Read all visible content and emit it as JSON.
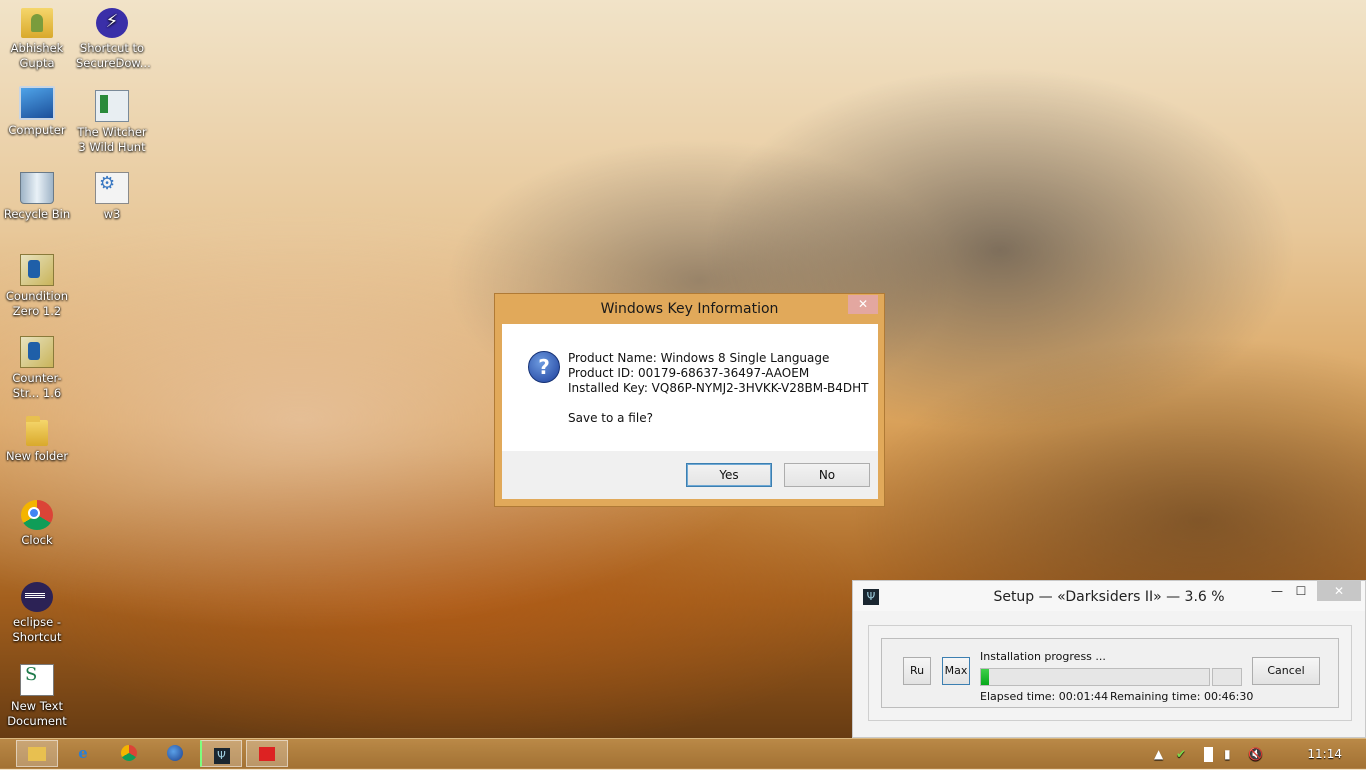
{
  "desktop": {
    "icons": [
      {
        "label": "Abhishek Gupta",
        "icon": "user-folder-icon"
      },
      {
        "label": "Shortcut to SecureDow...",
        "icon": "bolt-icon"
      },
      {
        "label": "Computer",
        "icon": "computer-icon"
      },
      {
        "label": "The Witcher 3 Wild Hunt",
        "icon": "witcher-icon"
      },
      {
        "label": "Recycle Bin",
        "icon": "recycle-bin-icon"
      },
      {
        "label": "w3",
        "icon": "settings-file-icon"
      },
      {
        "label": "Coundition Zero 1.2",
        "icon": "cs-icon"
      },
      {
        "label": "Counter-Str... 1.6",
        "icon": "cs-icon"
      },
      {
        "label": "New folder",
        "icon": "folder-icon"
      },
      {
        "label": "Clock",
        "icon": "chrome-icon"
      },
      {
        "label": "eclipse - Shortcut",
        "icon": "eclipse-icon"
      },
      {
        "label": "New Text Document",
        "icon": "text-document-icon"
      }
    ]
  },
  "dialog": {
    "title": "Windows Key Information",
    "close_glyph": "✕",
    "lines": [
      "Product Name: Windows 8 Single Language",
      "Product ID: 00179-68637-36497-AAOEM",
      "Installed Key: VQ86P-NYMJ2-3HVKK-V28BM-B4DHT"
    ],
    "question": "Save to a file?",
    "yes_label": "Yes",
    "no_label": "No"
  },
  "setup": {
    "title": "Setup — «Darksiders II» — 3.6 %",
    "minimize_glyph": "—",
    "maximize_glyph": "☐",
    "close_glyph": "✕",
    "ru_label": "Ru",
    "max_label": "Max",
    "progress_label": "Installation progress ...",
    "progress_fraction": 0.036,
    "elapsed_label": "Elapsed time: 00:01:44",
    "remaining_label": "Remaining time: 00:46:30",
    "cancel_label": "Cancel"
  },
  "taskbar": {
    "apps": [
      "file-explorer-icon",
      "internet-explorer-icon",
      "chrome-icon",
      "firefox-icon",
      "setup-icon",
      "key-tool-icon"
    ],
    "clock": "11:14",
    "accent": "#c8964f"
  }
}
